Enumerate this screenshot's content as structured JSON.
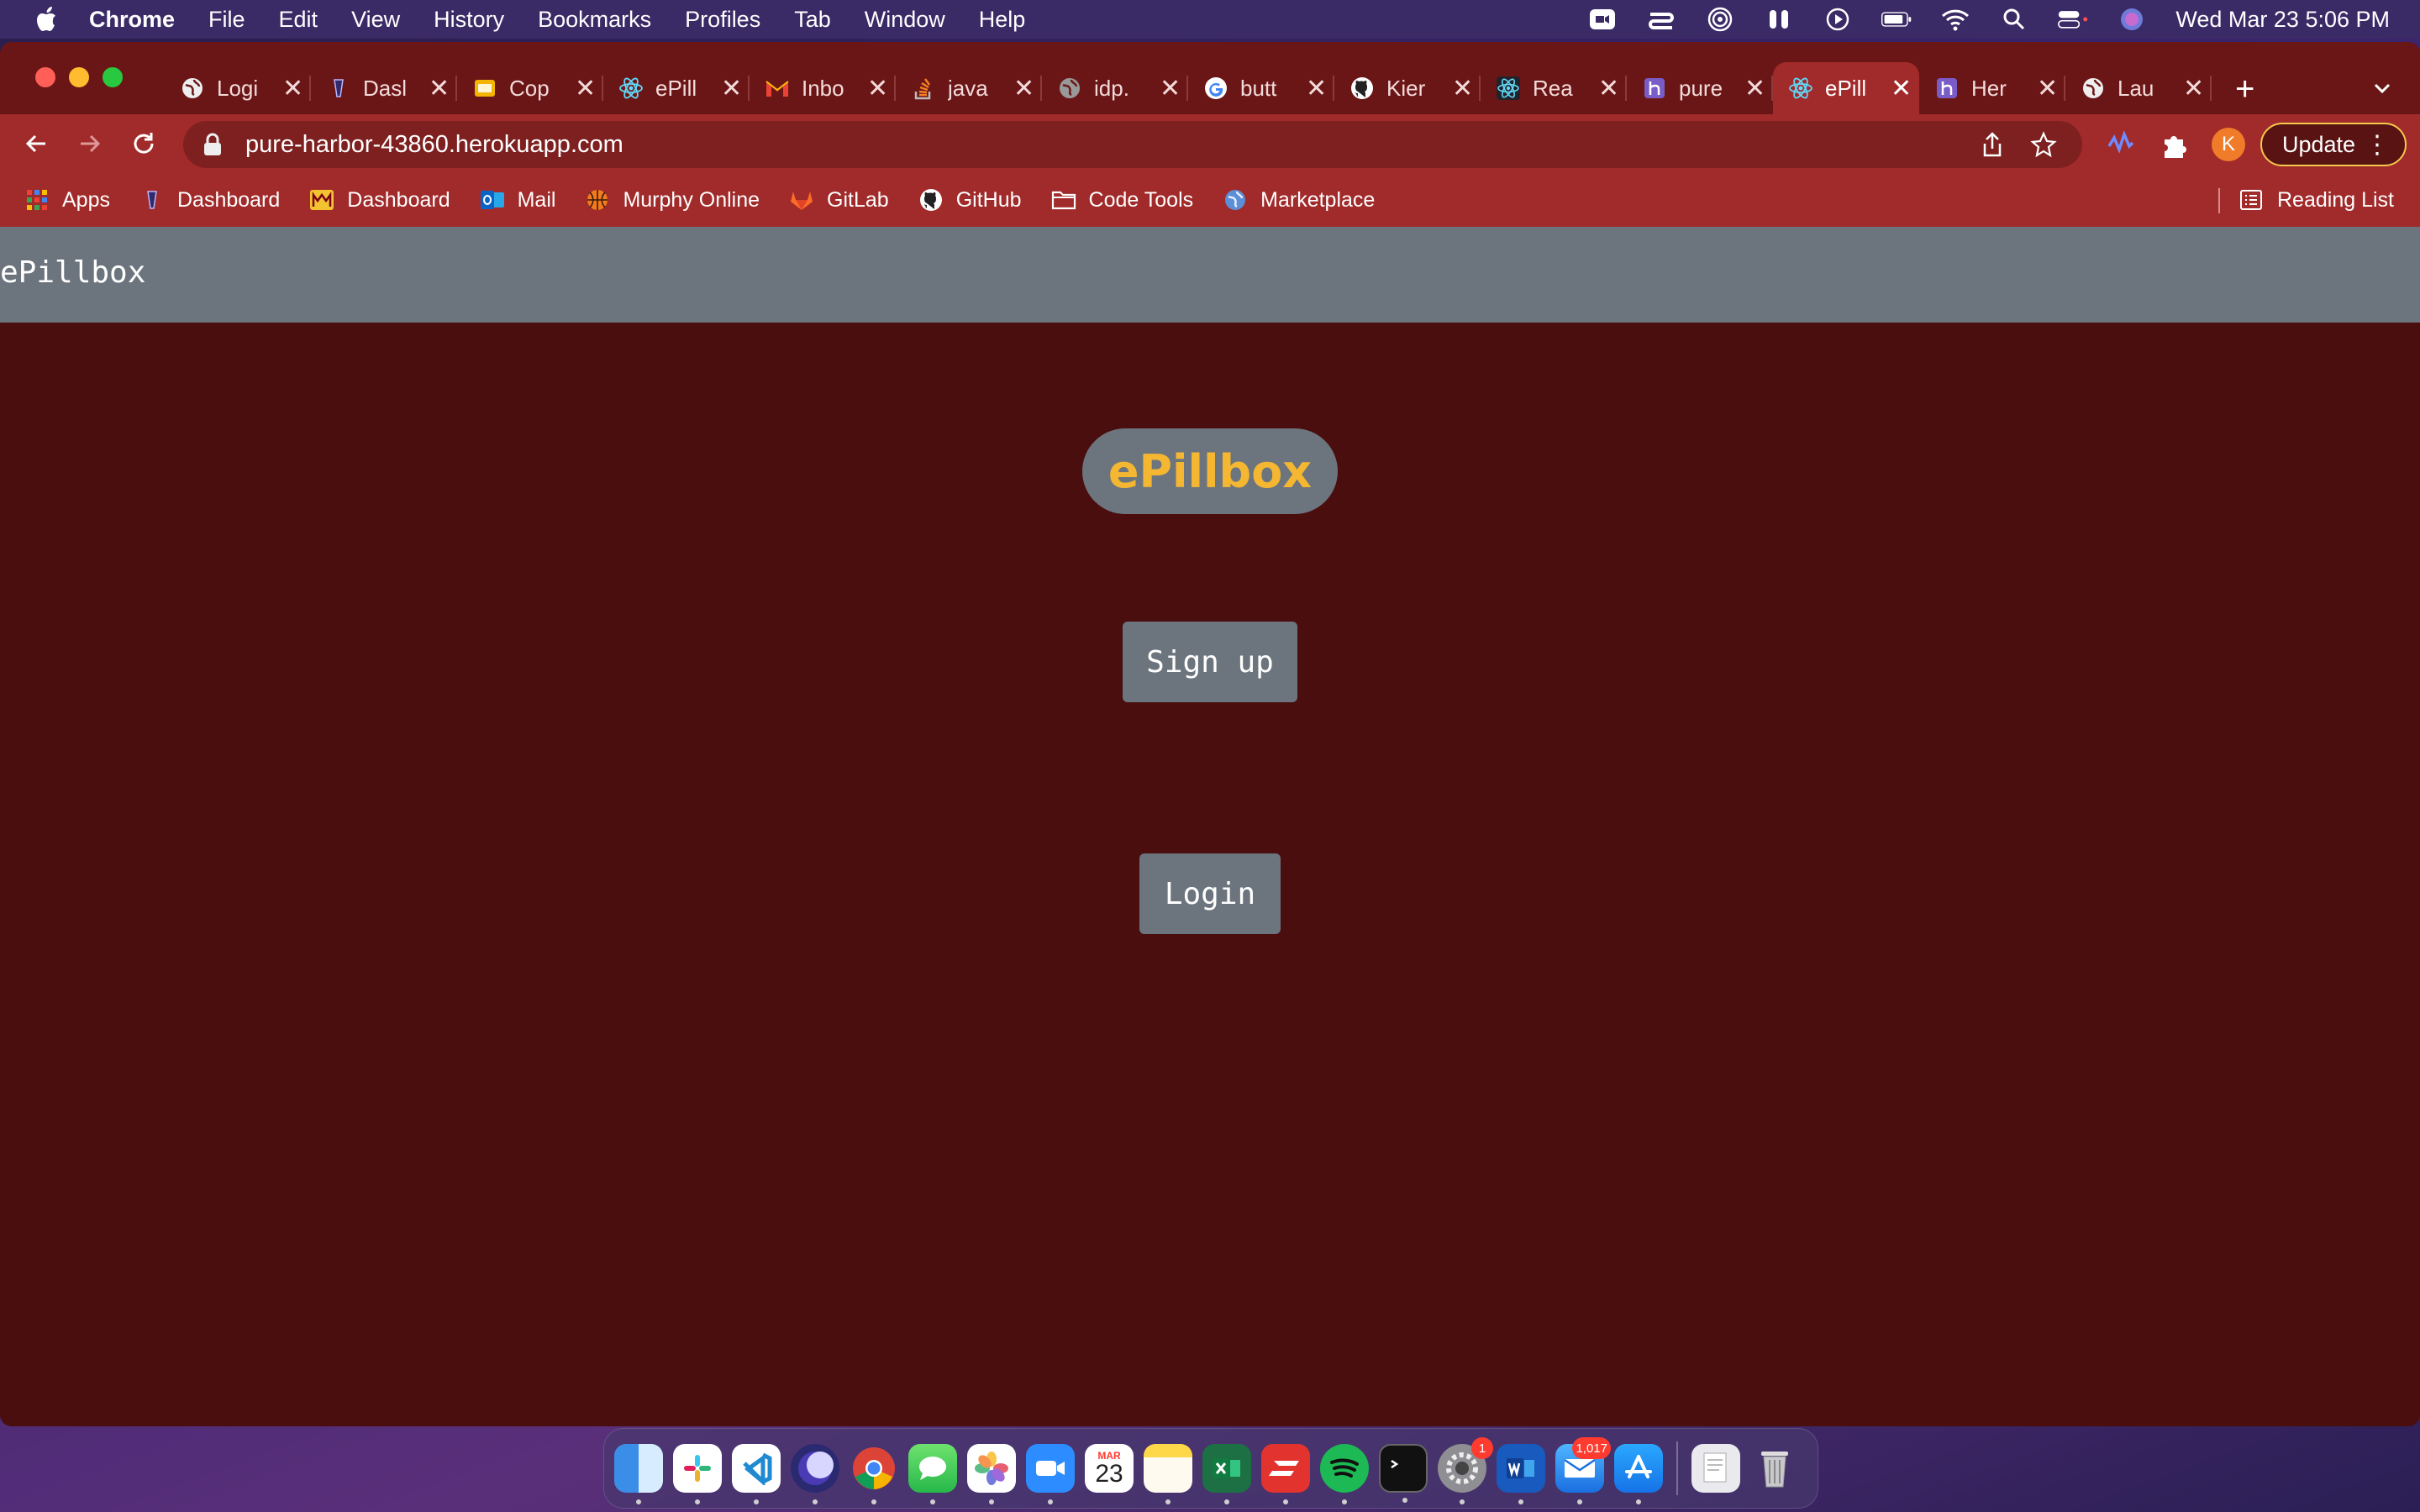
{
  "menubar": {
    "app_name": "Chrome",
    "items": [
      "File",
      "Edit",
      "View",
      "History",
      "Bookmarks",
      "Profiles",
      "Tab",
      "Window",
      "Help"
    ],
    "clock": "Wed Mar 23  5:06 PM"
  },
  "browser": {
    "tabs": [
      {
        "title": "Logi",
        "icon": "globe-icon"
      },
      {
        "title": "Dasl",
        "icon": "dashboard-icon"
      },
      {
        "title": "Cop",
        "icon": "slides-icon"
      },
      {
        "title": "ePill",
        "icon": "react-icon"
      },
      {
        "title": "Inbo",
        "icon": "gmail-icon"
      },
      {
        "title": "java",
        "icon": "stackoverflow-icon"
      },
      {
        "title": "idp.",
        "icon": "globe-icon"
      },
      {
        "title": "butt",
        "icon": "google-icon"
      },
      {
        "title": "Kier",
        "icon": "github-icon"
      },
      {
        "title": "Rea",
        "icon": "react-icon"
      },
      {
        "title": "pure",
        "icon": "heroku-icon"
      },
      {
        "title": "ePill",
        "icon": "react-icon",
        "active": true
      },
      {
        "title": "Her",
        "icon": "heroku-icon"
      },
      {
        "title": "Lau",
        "icon": "globe-icon"
      }
    ],
    "url": "pure-harbor-43860.herokuapp.com",
    "profile_initial": "K",
    "update_label": "Update",
    "bookmarks": [
      {
        "label": "Apps",
        "icon": "apps-grid-icon"
      },
      {
        "label": "Dashboard",
        "icon": "dashboard-icon"
      },
      {
        "label": "Dashboard",
        "icon": "university-icon"
      },
      {
        "label": "Mail",
        "icon": "outlook-icon"
      },
      {
        "label": "Murphy Online",
        "icon": "basketball-icon"
      },
      {
        "label": "GitLab",
        "icon": "gitlab-icon"
      },
      {
        "label": "GitHub",
        "icon": "github-icon"
      },
      {
        "label": "Code Tools",
        "icon": "folder-icon"
      },
      {
        "label": "Marketplace",
        "icon": "globe-icon"
      }
    ],
    "reading_list": "Reading List"
  },
  "page": {
    "appbar_title": "ePillbox",
    "hero_title": "ePillbox",
    "signup_label": "Sign up",
    "login_label": "Login"
  },
  "dock": {
    "calendar_month": "MAR",
    "calendar_day": "23",
    "settings_badge": "1",
    "mail_badge": "1,017"
  },
  "colors": {
    "page_background": "#4a0e0e",
    "appbar": "#6c757d",
    "hero_text": "#f5b731",
    "tabstrip": "#6b1616",
    "toolbar": "#a12a2a"
  }
}
